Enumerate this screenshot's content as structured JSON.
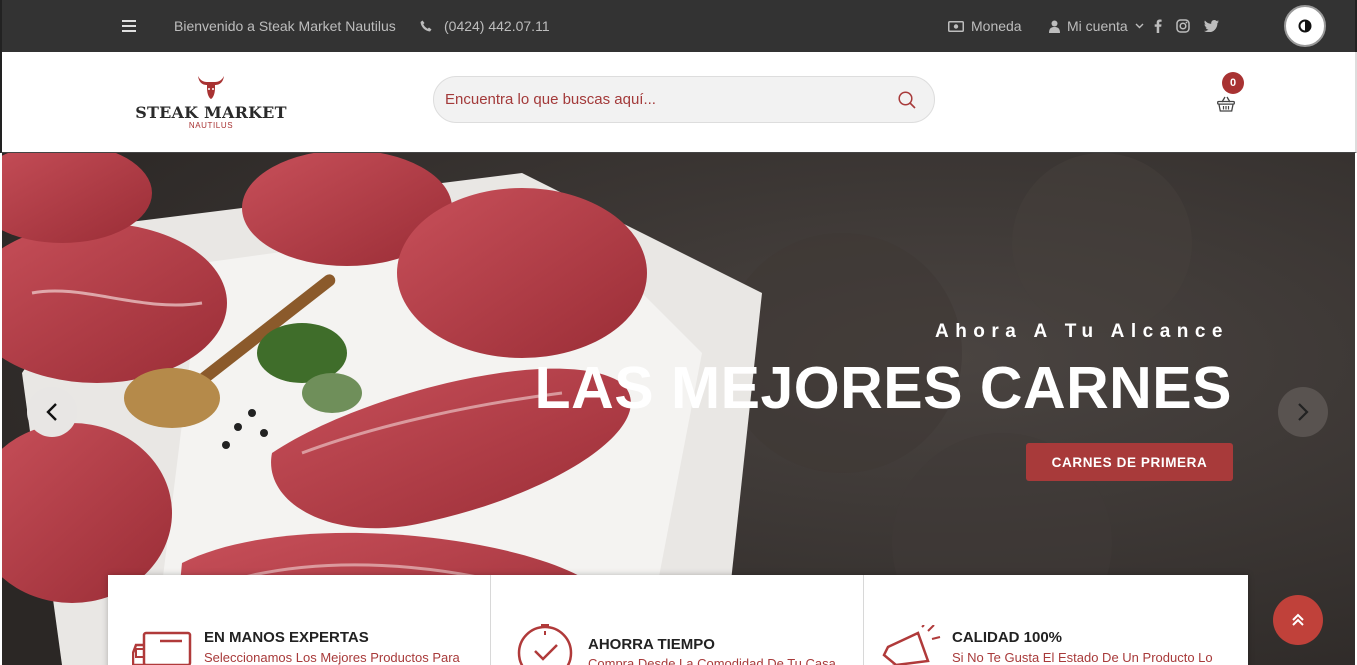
{
  "topbar": {
    "welcome": "Bienvenido a Steak Market Nautilus",
    "phone": "(0424) 442.07.11",
    "currency_label": "Moneda",
    "account_label": "Mi cuenta"
  },
  "header": {
    "logo_name": "STEAK MARKET",
    "logo_sub": "NAUTILUS",
    "search_placeholder": "Encuentra lo que buscas aquí...",
    "cart_count": "0"
  },
  "hero": {
    "slogan": "Ahora A Tu Alcance",
    "headline": "LAS MEJORES CARNES",
    "cta_label": "CARNES DE PRIMERA"
  },
  "features": [
    {
      "title": "EN MANOS EXPERTAS",
      "desc": "Seleccionamos Los Mejores Productos Para"
    },
    {
      "title": "AHORRA TIEMPO",
      "desc": "Compra Desde La Comodidad De Tu Casa"
    },
    {
      "title": "CALIDAD 100%",
      "desc": "Si No Te Gusta El Estado De Un Producto Lo"
    }
  ],
  "colors": {
    "brand_red": "#a83a3a",
    "topbar_bg": "#333333",
    "scroll_top_bg": "#c0413a"
  },
  "icons": [
    "menu-icon",
    "phone-icon",
    "money-icon",
    "user-icon",
    "chevron-down-icon",
    "facebook-icon",
    "instagram-icon",
    "twitter-icon",
    "contrast-icon",
    "search-icon",
    "basket-icon",
    "chevron-left-icon",
    "chevron-right-icon",
    "truck-icon",
    "clock-icon",
    "megaphone-icon",
    "double-chevron-up-icon"
  ]
}
